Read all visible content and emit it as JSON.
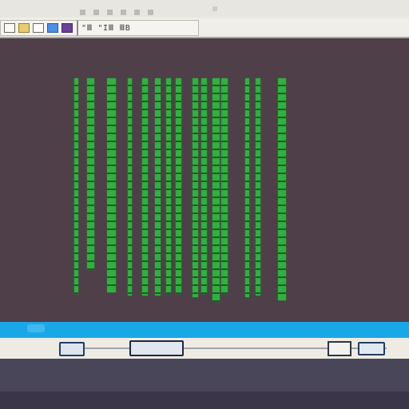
{
  "toolbar": {
    "group1_icons": [
      "document-icon",
      "folder-icon",
      "save-icon",
      "blue-icon",
      "purple-icon"
    ],
    "group2_label": "\"Ⅲ \"IⅢ ⅢB"
  },
  "visualization": {
    "type": "bar-columns",
    "color": "#2bb33b",
    "background": "#4e3f49"
  },
  "colors": {
    "accent_blue": "#1aa7e6",
    "bar_green": "#2bb33b",
    "bottom_panel": "#4a4659"
  }
}
